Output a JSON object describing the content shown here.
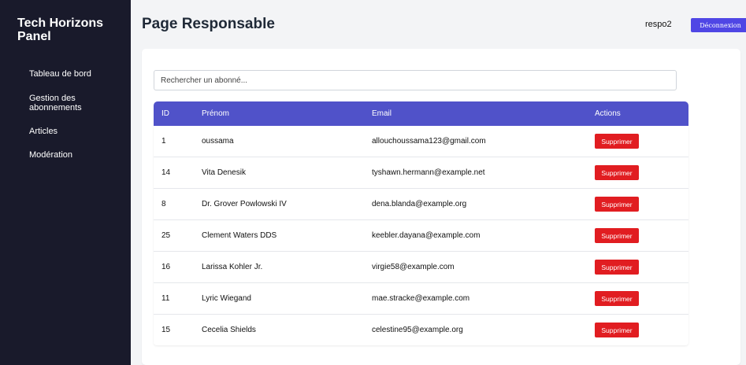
{
  "sidebar": {
    "brand": "Tech Horizons Panel",
    "items": [
      {
        "label": "Tableau de bord"
      },
      {
        "label": "Gestion des abonnements"
      },
      {
        "label": "Articles"
      },
      {
        "label": "Modération"
      }
    ]
  },
  "header": {
    "title": "Page Responsable",
    "username": "respo2",
    "logout_label": "Déconnexion"
  },
  "search": {
    "placeholder": "Rechercher un abonné..."
  },
  "table": {
    "columns": [
      "ID",
      "Prénom",
      "Email",
      "Actions"
    ],
    "delete_label": "Supprimer",
    "rows": [
      {
        "id": "1",
        "name": "oussama",
        "email": "allouchoussama123@gmail.com"
      },
      {
        "id": "14",
        "name": "Vita Denesik",
        "email": "tyshawn.hermann@example.net"
      },
      {
        "id": "8",
        "name": "Dr. Grover Powlowski IV",
        "email": "dena.blanda@example.org"
      },
      {
        "id": "25",
        "name": "Clement Waters DDS",
        "email": "keebler.dayana@example.com"
      },
      {
        "id": "16",
        "name": "Larissa Kohler Jr.",
        "email": "virgie58@example.com"
      },
      {
        "id": "11",
        "name": "Lyric Wiegand",
        "email": "mae.stracke@example.com"
      },
      {
        "id": "15",
        "name": "Cecelia Shields",
        "email": "celestine95@example.org"
      }
    ]
  },
  "colors": {
    "sidebar_bg": "#191a2b",
    "accent": "#4f46e5",
    "table_header": "#5052c9",
    "danger": "#e11d21"
  }
}
